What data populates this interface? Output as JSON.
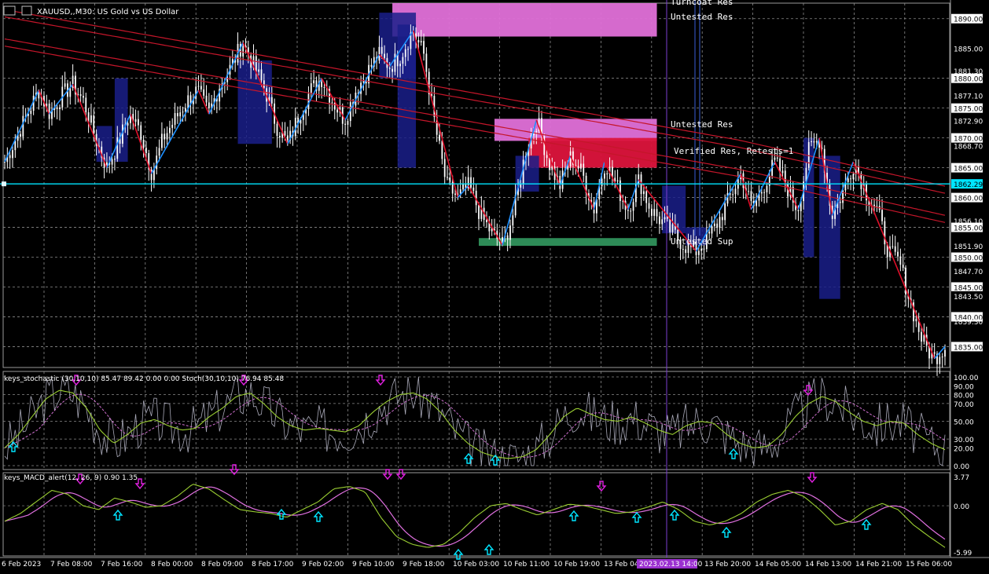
{
  "header": {
    "symbol_label": "XAUUSD,,M30: US Gold vs US Dollar"
  },
  "colors": {
    "background": "#000000",
    "grid": "#8a8a8a",
    "candle": "#ffffff",
    "zigzag_up": "#1e90ff",
    "zigzag_down": "#e0102a",
    "ma_lines": "#c4162a",
    "cyan_line": "#00e5ff",
    "res_zone_pink": "#e070d8",
    "res_zone_red": "#dc143c",
    "sup_zone_green": "#2e8b57",
    "stoch_main": "#9acd32",
    "stoch_signal": "#d070d0",
    "stoch_raw": "#a9a9b8",
    "macd_main": "#9acd32",
    "macd_signal": "#e070e0",
    "arrow_up": "#00e5ff",
    "arrow_down": "#e020e0",
    "date_highlight": "#9b30d0"
  },
  "zones": {
    "label_top_cut": "Turncoat Res",
    "label_top": "Untested Res",
    "label_mid": "Untested Res",
    "label_verified": "Verified Res, Retests=1",
    "label_support": "Untested Sup"
  },
  "stoch_panel": {
    "label": "keys_stochastic (30,10,10) 85.47 89.42 0.00 0.00 Stoch(30,10,10) 76.94 85.48"
  },
  "macd_panel": {
    "label": "keys_MACD_alert(12, 26, 9) 0.90 1.35"
  },
  "chart_data": [
    {
      "type": "candlestick",
      "symbol": "XAUUSD",
      "timeframe": "M30",
      "ylim": [
        1831.5,
        1892.6
      ],
      "y_ticks": [
        "1890.00",
        "1885.00",
        "1881.30",
        "1880.00",
        "1877.10",
        "1875.00",
        "1872.90",
        "1870.00",
        "1868.70",
        "1865.00",
        "1862.29",
        "1860.00",
        "1856.10",
        "1855.00",
        "1851.90",
        "1850.00",
        "1847.70",
        "1845.00",
        "1843.50",
        "1840.00",
        "1839.30",
        "1835.00"
      ],
      "y_tick_boxed": [
        "1890.00",
        "1880.00",
        "1875.00",
        "1870.00",
        "1865.00",
        "1860.00",
        "1855.00",
        "1850.00",
        "1845.00",
        "1840.00",
        "1835.00"
      ],
      "current_price": "1862.29",
      "last_label": "1843.50",
      "x_labels": [
        "6 Feb 2023",
        "7 Feb 08:00",
        "7 Feb 16:00",
        "8 Feb 00:00",
        "8 Feb 09:00",
        "8 Feb 17:00",
        "9 Feb 02:00",
        "9 Feb 10:00",
        "9 Feb 18:00",
        "10 Feb 03:00",
        "10 Feb 11:00",
        "10 Feb 19:00",
        "13 Feb 04",
        "2023.02.13 14:00",
        "13 Feb 20:00",
        "14 Feb 05:00",
        "14 Feb 13:00",
        "14 Feb 21:00",
        "15 Feb 06:00"
      ],
      "price_path": [
        1866,
        1870,
        1874,
        1878,
        1874,
        1877,
        1879,
        1876,
        1870,
        1865,
        1869,
        1874,
        1871,
        1864,
        1870,
        1873,
        1876,
        1878,
        1874,
        1879,
        1882,
        1886,
        1882,
        1878,
        1872,
        1869,
        1874,
        1878,
        1880,
        1876,
        1873,
        1878,
        1881,
        1884,
        1882,
        1884,
        1888,
        1884,
        1872,
        1862,
        1860,
        1862,
        1857,
        1854,
        1852,
        1858,
        1868,
        1873,
        1866,
        1862,
        1867,
        1864,
        1858,
        1866,
        1862,
        1858,
        1863,
        1858,
        1856,
        1854,
        1852,
        1851,
        1853,
        1856,
        1860,
        1864,
        1858,
        1862,
        1866,
        1862,
        1858,
        1868,
        1870,
        1857,
        1861,
        1866,
        1861,
        1858,
        1851,
        1849,
        1842,
        1836,
        1833,
        1835
      ],
      "support_low": 1852.6
    },
    {
      "type": "line",
      "name": "keys_stochastic",
      "ylim": [
        0,
        100
      ],
      "y_ticks": [
        "100.00",
        "90.00",
        "80.00",
        "70.00",
        "50.00",
        "30.00",
        "20.00",
        "0.00"
      ],
      "main_path": [
        20,
        35,
        55,
        75,
        85,
        82,
        65,
        40,
        25,
        35,
        48,
        52,
        45,
        40,
        42,
        55,
        65,
        78,
        82,
        70,
        55,
        45,
        40,
        42,
        40,
        38,
        45,
        60,
        72,
        80,
        82,
        75,
        60,
        40,
        25,
        15,
        10,
        8,
        10,
        18,
        35,
        55,
        65,
        58,
        52,
        50,
        55,
        48,
        40,
        35,
        45,
        50,
        48,
        35,
        25,
        20,
        22,
        35,
        55,
        70,
        78,
        72,
        60,
        50,
        45,
        50,
        48,
        35,
        25,
        18
      ]
    },
    {
      "type": "line",
      "name": "keys_MACD_alert",
      "ylim": [
        -5.99,
        3.77
      ],
      "y_ticks": [
        "3.77",
        "0.00",
        "-5.99"
      ],
      "main_path": [
        -2,
        -1,
        0.5,
        2,
        1.5,
        0,
        -0.5,
        1,
        0.5,
        -0.2,
        0,
        1.2,
        2.8,
        2.2,
        0.8,
        -0.5,
        -0.8,
        -1,
        -1.5,
        -0.5,
        0.5,
        2.2,
        2.5,
        1.8,
        -1.5,
        -4,
        -5,
        -5.4,
        -5,
        -3.5,
        -1.5,
        0,
        0.3,
        -0.5,
        -1.2,
        -0.5,
        0.2,
        0,
        -0.5,
        -1,
        -0.8,
        -0.2,
        0.5,
        -0.5,
        -2,
        -2.5,
        -2,
        -1,
        0.5,
        1.5,
        2,
        1.2,
        -0.5,
        -2.5,
        -2,
        -0.5,
        0.3,
        -0.5,
        -2.5,
        -4,
        -5.4
      ]
    }
  ]
}
